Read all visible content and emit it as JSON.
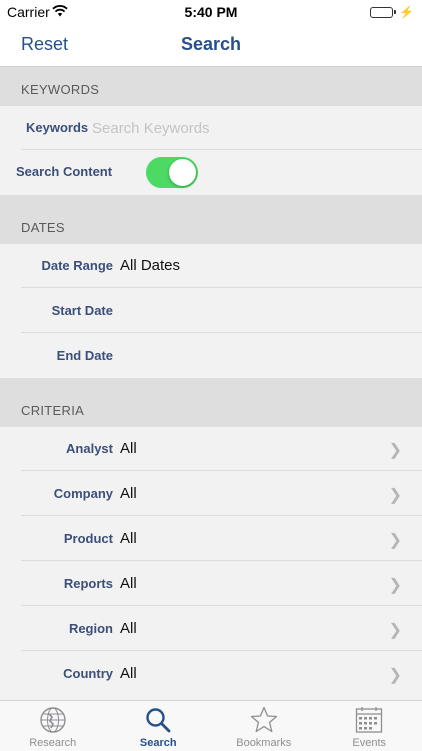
{
  "status_bar": {
    "carrier": "Carrier",
    "time": "5:40 PM",
    "battery_level": 0.95
  },
  "nav": {
    "left_button": "Reset",
    "title": "Search"
  },
  "keywords": {
    "header": "KEYWORDS",
    "label": "Keywords",
    "placeholder": "Search Keywords",
    "value": "",
    "search_content_label": "Search Content",
    "search_content_on": true
  },
  "dates": {
    "header": "DATES",
    "rows": [
      {
        "label": "Date Range",
        "value": "All Dates"
      },
      {
        "label": "Start Date",
        "value": ""
      },
      {
        "label": "End Date",
        "value": ""
      }
    ]
  },
  "criteria": {
    "header": "CRITERIA",
    "rows": [
      {
        "label": "Analyst",
        "value": "All"
      },
      {
        "label": "Company",
        "value": "All"
      },
      {
        "label": "Product",
        "value": "All"
      },
      {
        "label": "Reports",
        "value": "All"
      },
      {
        "label": "Region",
        "value": "All"
      },
      {
        "label": "Country",
        "value": "All"
      }
    ]
  },
  "tabs": [
    {
      "label": "Research",
      "icon": "globe-icon",
      "active": false
    },
    {
      "label": "Search",
      "icon": "search-icon",
      "active": true
    },
    {
      "label": "Bookmarks",
      "icon": "star-icon",
      "active": false
    },
    {
      "label": "Events",
      "icon": "calendar-icon",
      "active": false
    }
  ],
  "colors": {
    "accent": "#27508a",
    "toggle_on": "#4cd964",
    "label": "#3b4f7a",
    "section_bg": "#dedede",
    "tab_inactive": "#8e8e93"
  }
}
